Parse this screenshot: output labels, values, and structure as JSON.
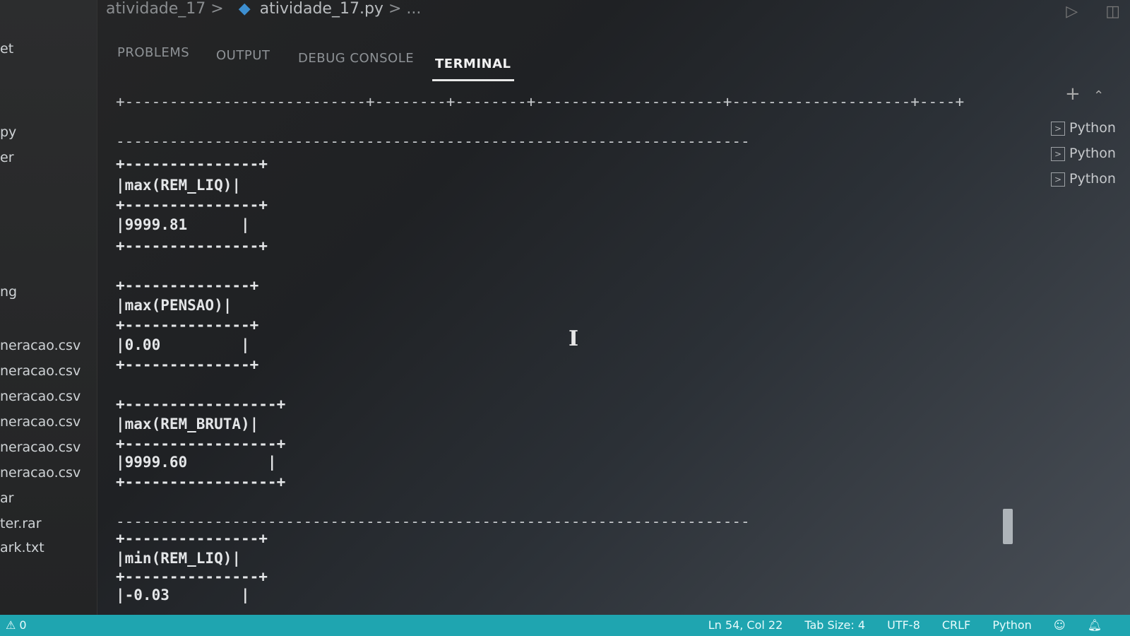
{
  "breadcrumb": {
    "folder": "atividade_17",
    "sep1": ">",
    "file": "atividade_17.py",
    "sep2": ">",
    "more": "..."
  },
  "sidebar": {
    "items": [
      "et",
      "py",
      "er",
      "ng",
      "neracao.csv",
      "neracao.csv",
      "neracao.csv",
      "neracao.csv",
      "neracao.csv",
      "neracao.csv",
      "ar",
      "ter.rar",
      "ark.txt"
    ]
  },
  "panel": {
    "tabs": [
      "PROBLEMS",
      "OUTPUT",
      "DEBUG CONSOLE",
      "TERMINAL"
    ],
    "active_tab": "TERMINAL"
  },
  "terminal": {
    "lines": [
      "+---------------------------+--------+--------+---------------------+--------------------+----+",
      "-----------------------------------------------------------------------",
      "+---------------+",
      "|max(REM_LIQ)|",
      "+---------------+",
      "|9999.81      |",
      "+---------------+",
      "+--------------+",
      "|max(PENSAO)|",
      "+--------------+",
      "|0.00         |",
      "+--------------+",
      "+-----------------+",
      "|max(REM_BRUTA)|",
      "+-----------------+",
      "|9999.60         |",
      "+-----------------+",
      "-----------------------------------------------------------------------",
      "+---------------+",
      "|min(REM_LIQ)|",
      "+---------------+",
      "|-0.03        |"
    ]
  },
  "terminal_list": {
    "items": [
      "Python",
      "Python",
      "Python"
    ]
  },
  "icons": {
    "add": "add-terminal-icon",
    "run": "run-icon",
    "split": "split-editor-icon"
  },
  "statusbar": {
    "problems": "⚠ 0",
    "position": "Ln 54, Col 22",
    "tab_size": "Tab Size: 4",
    "encoding": "UTF-8",
    "eol": "CRLF",
    "language": "Python"
  },
  "colors": {
    "statusbar": "#1fa5b0",
    "active_tab": "#f2f2f2"
  }
}
